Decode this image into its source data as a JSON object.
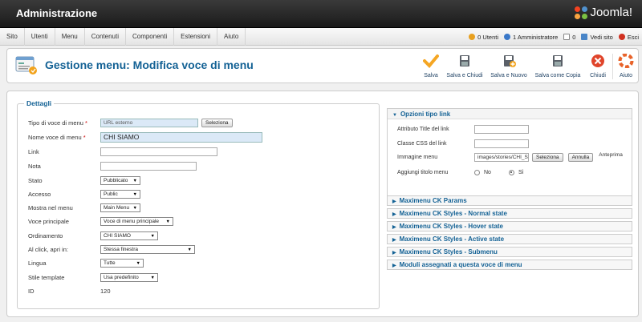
{
  "header": {
    "title": "Administrazione",
    "brand": "Joomla!"
  },
  "menubar": {
    "items": [
      "Sito",
      "Utenti",
      "Menu",
      "Contenuti",
      "Componenti",
      "Estensioni",
      "Aiuto"
    ],
    "status": {
      "users": "0 Utenti",
      "admins": "1 Amministratore",
      "messages": "0",
      "view_site": "Vedi sito",
      "logout": "Esci"
    }
  },
  "toolbar": {
    "page_title": "Gestione menu: Modifica voce di menu",
    "buttons": {
      "save": "Salva",
      "save_close": "Salva e Chiudi",
      "save_new": "Salva e Nuovo",
      "save_copy": "Salva come Copia",
      "close": "Chiudi",
      "help": "Aiuto"
    }
  },
  "details": {
    "legend": "Dettagli",
    "type_label": "Tipo di voce di menu",
    "type_value": "URL esterno",
    "type_button": "Seleziona",
    "name_label": "Nome voce di menu",
    "name_value": "CHI SIAMO",
    "link_label": "Link",
    "link_value": "",
    "note_label": "Nota",
    "note_value": "",
    "state_label": "Stato",
    "state_value": "Pubblicato",
    "access_label": "Accesso",
    "access_value": "Public",
    "show_in_menu_label": "Mostra nel menu",
    "show_in_menu_value": "Main Menu",
    "parent_label": "Voce principale",
    "parent_value": "Voce di menu principale",
    "order_label": "Ordinamento",
    "order_value": "CHI SIAMO",
    "onclick_label": "Al click, apri in:",
    "onclick_value": "Stessa finestra",
    "language_label": "Lingua",
    "language_value": "Tutte",
    "template_label": "Stile template",
    "template_value": "Usa predefinito",
    "id_label": "ID",
    "id_value": "120",
    "required_mark": "*"
  },
  "options": {
    "title": "Opzioni tipo link",
    "title_attr_label": "Attributo Title del link",
    "title_attr_value": "",
    "css_label": "Classe CSS del link",
    "css_value": "",
    "image_label": "Immagine menu",
    "image_value": "images/stories/CHI_SI...",
    "image_select": "Seleziona",
    "image_cancel": "Annulla",
    "image_preview": "Anteprima",
    "add_title_label": "Aggiungi titolo menu",
    "no": "No",
    "yes": "Sì"
  },
  "panels": [
    "Maximenu CK Params",
    "Maximenu CK Styles - Normal state",
    "Maximenu CK Styles - Hover state",
    "Maximenu CK Styles - Active state",
    "Maximenu CK Styles - Submenu",
    "Moduli assegnati a questa voce di menu"
  ],
  "colors": {
    "accent": "#146295",
    "save": "#f5a623",
    "close": "#e0452b",
    "help": "#e8632a"
  },
  "icons": [
    "joomla-logo-icon",
    "users-icon",
    "admin-icon",
    "messages-icon",
    "view-site-icon",
    "logout-icon",
    "menu-manager-icon",
    "save-check-icon",
    "floppy-icon",
    "close-x-icon",
    "help-icon"
  ]
}
